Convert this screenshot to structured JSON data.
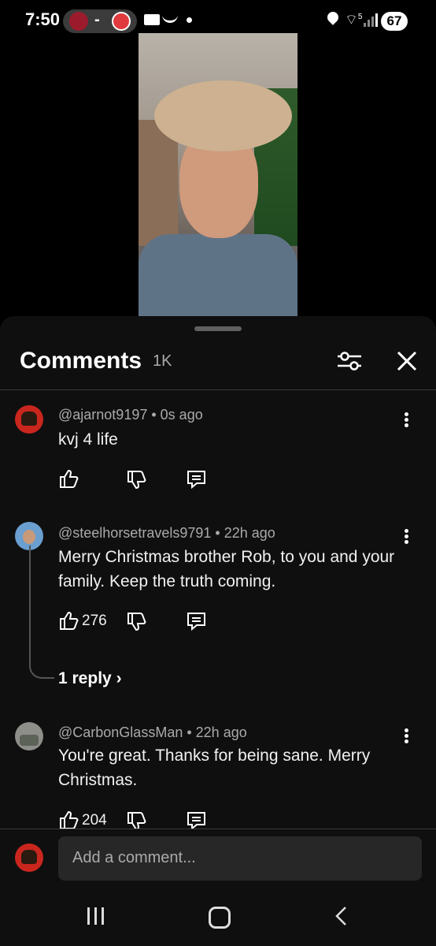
{
  "status_bar": {
    "time": "7:50",
    "score_separator": "-",
    "battery": "67",
    "wifi_label": "5"
  },
  "header": {
    "title": "Comments",
    "count": "1K"
  },
  "comments": [
    {
      "author": "@ajarnot9197",
      "time": "0s ago",
      "text": "kvj 4 life",
      "likes": ""
    },
    {
      "author": "@steelhorsetravels9791",
      "time": "22h ago",
      "text": "Merry Christmas brother Rob, to you and your family.  Keep the truth coming.",
      "likes": "276",
      "reply_label": "1 reply"
    },
    {
      "author": "@CarbonGlassMan",
      "time": "22h ago",
      "text": "You're great. Thanks for being sane. Merry Christmas.",
      "likes": "204"
    }
  ],
  "add_comment": {
    "placeholder": "Add a comment..."
  },
  "colors": {
    "background": "#0f0f0f",
    "input": "#272727",
    "muted_text": "#aaaaaa"
  }
}
